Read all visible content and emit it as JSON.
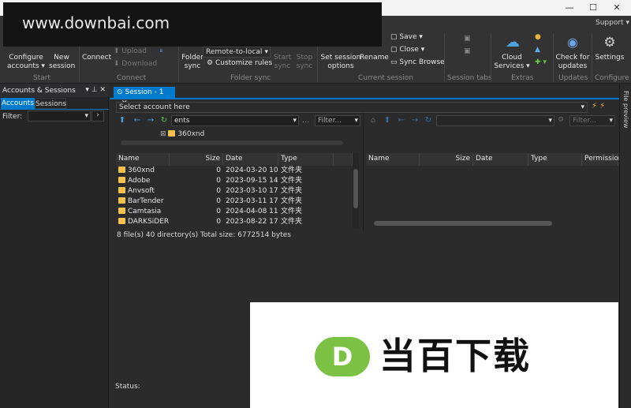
{
  "watermark": {
    "text": "www.downbai.com"
  },
  "window": {
    "minimize": "—",
    "maximize": "☐",
    "close": "✕",
    "support": "Support ▾"
  },
  "ribbon": {
    "configure_accounts": "Configure accounts ▾",
    "new_session": "New session",
    "connect": "Connect",
    "upload": "Upload",
    "download": "Download",
    "folder_sync": "Folder sync",
    "sync_mode": "Remote-to-local",
    "customize_rules": "Customize rules",
    "start_sync": "Start sync",
    "stop_sync": "Stop sync",
    "set_session_options": "Set session options",
    "rename": "Rename",
    "save": "Save ▾",
    "close": "Close ▾",
    "sync_browse": "Sync Browse",
    "cloud_services": "Cloud Services ▾",
    "check_updates": "Check for updates",
    "settings": "Settings",
    "groups": {
      "start": "Start",
      "connect": "Connect",
      "folder_sync": "Folder sync",
      "current_session": "Current session",
      "session_tabs": "Session tabs",
      "extras": "Extras",
      "updates": "Updates",
      "configure": "Configure"
    }
  },
  "left_panel": {
    "title": "Accounts & Sessions",
    "tabs": [
      "Accounts",
      "Sessions"
    ],
    "filter_label": "Filter:"
  },
  "session": {
    "tab_label": "Session - 1",
    "account_placeholder": "Select account here",
    "local_path": "ents",
    "filter_placeholder": "Filter...",
    "tree_item": "360xnd",
    "status_label": "Status:"
  },
  "local_table": {
    "headers": [
      "Name",
      "Size",
      "Date",
      "Type"
    ],
    "rows": [
      {
        "name": "360xnd",
        "size": "0",
        "date": "2024-03-20 10:...",
        "type": "文件夹"
      },
      {
        "name": "Adobe",
        "size": "0",
        "date": "2023-09-15 14:...",
        "type": "文件夹"
      },
      {
        "name": "Anvsoft",
        "size": "0",
        "date": "2023-03-10 17:...",
        "type": "文件夹"
      },
      {
        "name": "BarTender",
        "size": "0",
        "date": "2023-03-11 17:...",
        "type": "文件夹"
      },
      {
        "name": "Camtasia",
        "size": "0",
        "date": "2024-04-08 11:...",
        "type": "文件夹"
      },
      {
        "name": "DARKSiDERS",
        "size": "0",
        "date": "2023-08-22 17:...",
        "type": "文件夹"
      }
    ],
    "summary": "8 file(s)  40 directory(s) Total size: 6772514 bytes"
  },
  "remote_table": {
    "headers": [
      "Name",
      "Size",
      "Date",
      "Type",
      "Permission"
    ],
    "filter_placeholder": "Filter..."
  },
  "preview_label": "File preview",
  "ad": {
    "logo_letter": "D",
    "brand_text": "当百下载",
    "logo_color": "#7bc144"
  }
}
